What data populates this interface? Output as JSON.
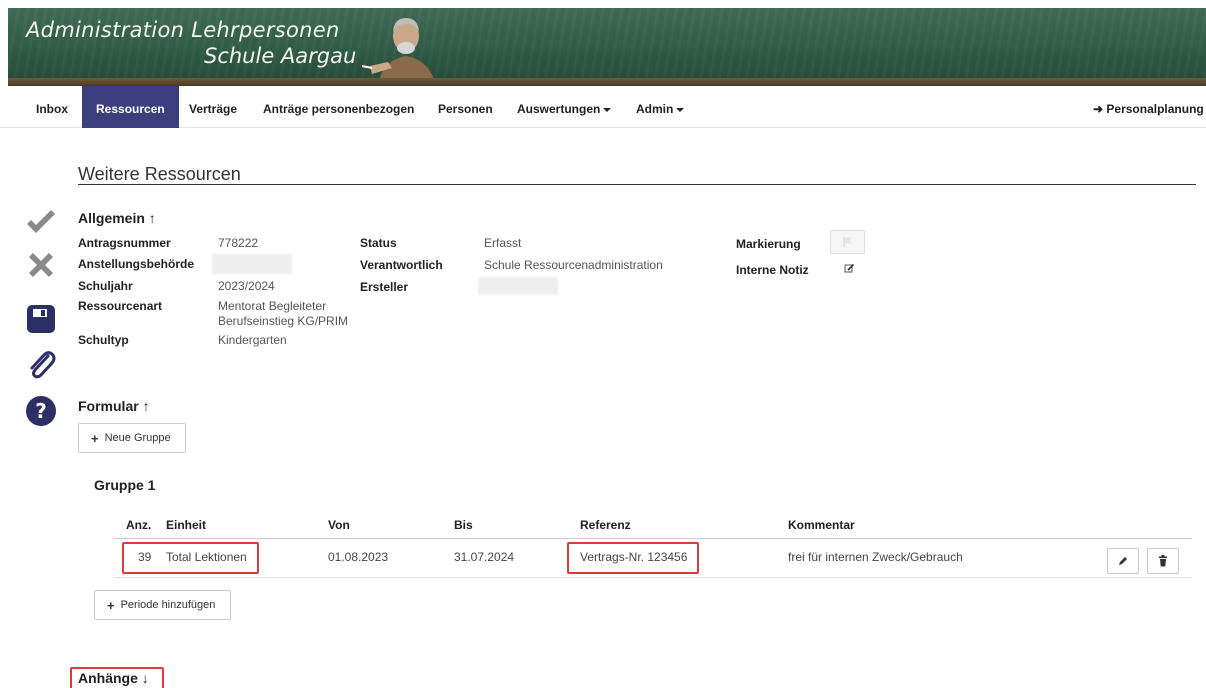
{
  "header": {
    "title_line1": "Administration Lehrpersonen",
    "title_line2": "Schule Aargau"
  },
  "nav": {
    "items": [
      {
        "label": "Inbox"
      },
      {
        "label": "Ressourcen",
        "active": true
      },
      {
        "label": "Verträge"
      },
      {
        "label": "Anträge personenbezogen"
      },
      {
        "label": "Personen"
      },
      {
        "label": "Auswertungen",
        "dropdown": true
      },
      {
        "label": "Admin",
        "dropdown": true
      }
    ],
    "right_link": "Personalplanung"
  },
  "rail": {
    "icons": [
      "check-icon",
      "close-icon",
      "save-icon",
      "paperclip-icon",
      "help-icon"
    ]
  },
  "page": {
    "title": "Weitere Ressourcen"
  },
  "allgemein": {
    "heading": "Allgemein",
    "arrow": "↑",
    "fields": {
      "antragsnummer_label": "Antragsnummer",
      "antragsnummer_value": "778222",
      "anstellungsbehoerde_label": "Anstellungsbehörde",
      "schuljahr_label": "Schuljahr",
      "schuljahr_value": "2023/2024",
      "ressourcenart_label": "Ressourcenart",
      "ressourcenart_value_1": "Mentorat Begleiteter",
      "ressourcenart_value_2": "Berufseinstieg KG/PRIM",
      "schultyp_label": "Schultyp",
      "schultyp_value": "Kindergarten",
      "status_label": "Status",
      "status_value": "Erfasst",
      "verantwortlich_label": "Verantwortlich",
      "verantwortlich_value": "Schule Ressourcenadministration",
      "ersteller_label": "Ersteller",
      "markierung_label": "Markierung",
      "interne_notiz_label": "Interne Notiz"
    }
  },
  "formular": {
    "heading": "Formular",
    "arrow": "↑",
    "new_group_button": "Neue Gruppe",
    "group_title": "Gruppe 1",
    "columns": [
      "Anz.",
      "Einheit",
      "Von",
      "Bis",
      "Referenz",
      "Kommentar"
    ],
    "rows": [
      {
        "anz": "39",
        "einheit": "Total Lektionen",
        "von": "01.08.2023",
        "bis": "31.07.2024",
        "referenz": "Vertrags-Nr. 123456",
        "kommentar": "frei für internen Zweck/Gebrauch"
      }
    ],
    "add_period_button": "Periode hinzufügen"
  },
  "anhaenge": {
    "heading": "Anhänge",
    "arrow": "↓"
  },
  "colors": {
    "nav_active": "#3b3f7c",
    "highlight": "#e03b3b",
    "icon_gray": "#8a8a8a",
    "icon_navy": "#2c2f63"
  }
}
